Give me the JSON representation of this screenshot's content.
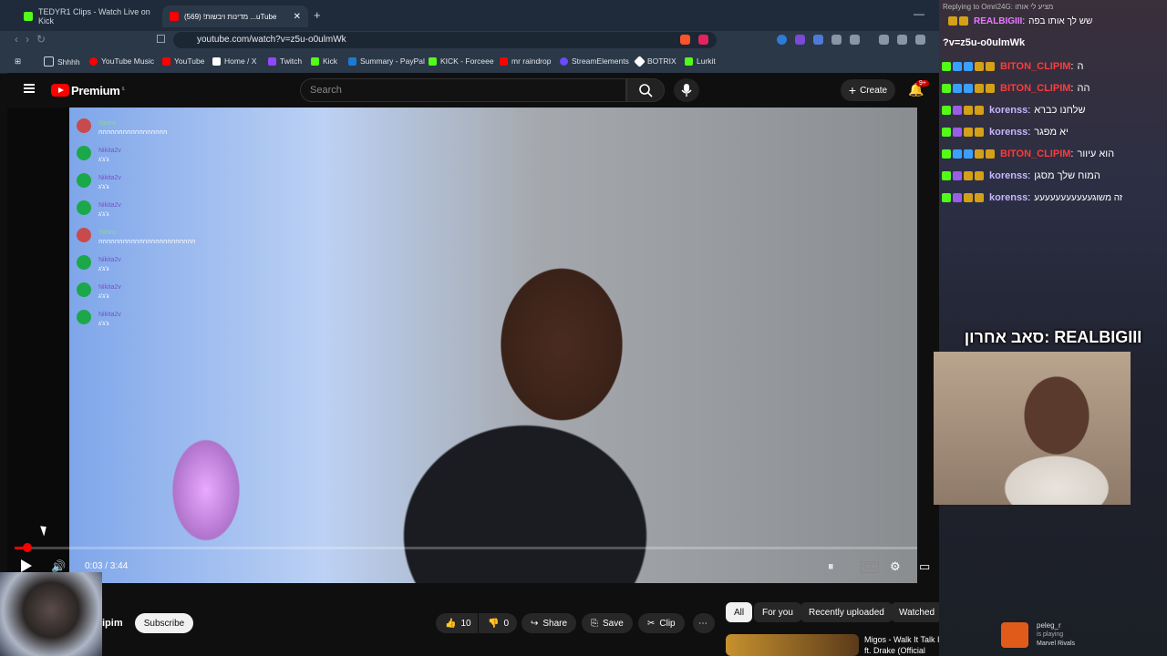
{
  "browser": {
    "tabs": [
      {
        "label": "TEDYR1 Clips - Watch Live on Kick",
        "favicon_color": "#53fc18"
      },
      {
        "label": "מדינות ויבשות! (569) ...uTube",
        "favicon_color": "#ff0000",
        "close": "✕"
      }
    ],
    "new_tab": "+",
    "minimize": "—",
    "url": "youtube.com/watch?v=z5u-o0ulmWk",
    "bookmarks": [
      {
        "label": "Shhhh",
        "color": "#cfd6df"
      },
      {
        "label": "YouTube Music",
        "color": "#ff0000"
      },
      {
        "label": "YouTube",
        "color": "#ff0000"
      },
      {
        "label": "Home / X",
        "color": "#ffffff"
      },
      {
        "label": "Twitch",
        "color": "#9146ff"
      },
      {
        "label": "Kick",
        "color": "#53fc18"
      },
      {
        "label": "Summary - PayPal",
        "color": "#1c7ad6"
      },
      {
        "label": "KICK - Forceee",
        "color": "#53fc18"
      },
      {
        "label": "mr raindrop",
        "color": "#ff0000"
      },
      {
        "label": "StreamElements",
        "color": "#6d4aff"
      },
      {
        "label": "BOTRIX",
        "color": "#ffffff"
      },
      {
        "label": "Lurkit",
        "color": "#53fc18"
      }
    ]
  },
  "youtube": {
    "brand": "Premium",
    "brand_sup": "IL",
    "search_placeholder": "Search",
    "create_label": "Create",
    "bell_badge": "9+",
    "player": {
      "time": "0:03 / 3:44",
      "progress_fraction": 0.014
    },
    "overlay_chat": [
      {
        "name": "Yarino",
        "text": "ההההההההההההההההה",
        "avatar": "#c84b4b"
      },
      {
        "name": "Nikita2v",
        "text": "ג'ג'ג",
        "avatar": "#1aa84a"
      },
      {
        "name": "Nikita2v",
        "text": "ג'ג'ג",
        "avatar": "#1aa84a"
      },
      {
        "name": "Nikita2v",
        "text": "ג'ג'ג",
        "avatar": "#1aa84a"
      },
      {
        "name": "Yarino",
        "text": "הההההההההההההההההההההההה",
        "avatar": "#c84b4b"
      },
      {
        "name": "Nikita2v",
        "text": "ג'ג'ג",
        "avatar": "#1aa84a"
      },
      {
        "name": "Nikita2v",
        "text": "ג'ג'ג",
        "avatar": "#1aa84a"
      },
      {
        "name": "Nikita2v",
        "text": "ג'ג'ג",
        "avatar": "#1aa84a"
      }
    ],
    "channel_name": "ipim",
    "subscribe_label": "Subscribe",
    "likes": "10",
    "dislikes": "0",
    "share_label": "Share",
    "save_label": "Save",
    "clip_label": "Clip",
    "chips": [
      "All",
      "For you",
      "Recently uploaded",
      "Watched"
    ],
    "recommendation_title": "Migos - Walk It Talk It ft. Drake (Official"
  },
  "stream_panel": {
    "replying_to": "Replying to Omri24G: מציע לי אותו",
    "top_message_user": "REALBIGIII",
    "top_message_text": "שש לך אותו בפה",
    "url_fragment": "?v=z5u-o0ulmWk",
    "chat": [
      {
        "user": "BITON_CLIPIM",
        "text": "ה",
        "color": "#ff3b3b"
      },
      {
        "user": "BITON_CLIPIM",
        "text": "הה",
        "color": "#ff3b3b"
      },
      {
        "user": "korenss",
        "text": "שלחנו כברא",
        "color": "#c7b6ff"
      },
      {
        "user": "korenss",
        "text": "יא מפגר",
        "color": "#c7b6ff"
      },
      {
        "user": "BITON_CLIPIM",
        "text": "הוא עיוור",
        "color": "#ff3b3b"
      },
      {
        "user": "korenss",
        "text": "המוח שלך מסגן",
        "color": "#c7b6ff"
      },
      {
        "user": "korenss",
        "text": "זה משוגעעעעעעעעעעע",
        "color": "#c7b6ff"
      }
    ],
    "sub_overlay": "סאב אחרון: REALBIGIII",
    "notification": {
      "name": "peleg_r",
      "status": "is playing",
      "game": "Marvel Rivals"
    }
  }
}
